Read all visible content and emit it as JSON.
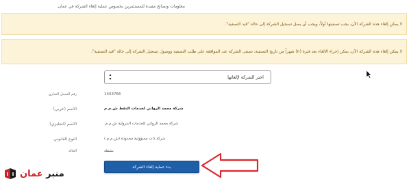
{
  "info_title": "معلومات ونصائح مفيدة للمستثمرين بخصوص عملية إلغاء الشركة في عمان.",
  "alerts": [
    "لا يمكن إلغاء هذه الشركة الآن، يجب تصفيتها أولاً، ويجب أن يصل تسجيل الشركة إلى حالة \"قيد التصفية\".",
    "لا يمكن إلغاء هذه الشركة الآن، يمكن إجراء الالغاء بعد فترة (n) شهراً من تاريخ التصفية، تصفى الشركة عند الموافقة على طلب التصفية ووصول تسجيل الشركة إلى حالة \"قيد التصفية\"."
  ],
  "select": {
    "value": "اختر الشركة لإلغائها"
  },
  "fields": {
    "cr_number": {
      "label": "رقم السجل التجاري",
      "value": "1403766"
    },
    "name_ar": {
      "label": "الاسم (عربي)",
      "value": "شركة محمد الرواتي لخدمات النفط ش.م.م"
    },
    "name_en": {
      "label": "الاسم (انجليزي)",
      "value": "شركة محمد الرواتي للخدمات البترولية ش.م.م."
    },
    "legal_type": {
      "label": "النوع القانوني",
      "value": "شركة ذات مسؤولية محدودة (ش.م.م.)"
    },
    "status": {
      "label": "الحالة",
      "value": "نشطة"
    }
  },
  "submit_button": "بدء عملية إلغاء الشركة",
  "logo": {
    "main": "منبر",
    "accent": "عمان"
  },
  "colors": {
    "button": "#1f5fa8",
    "alert_bg": "#fcf3d8",
    "arrow": "#d9262c"
  }
}
